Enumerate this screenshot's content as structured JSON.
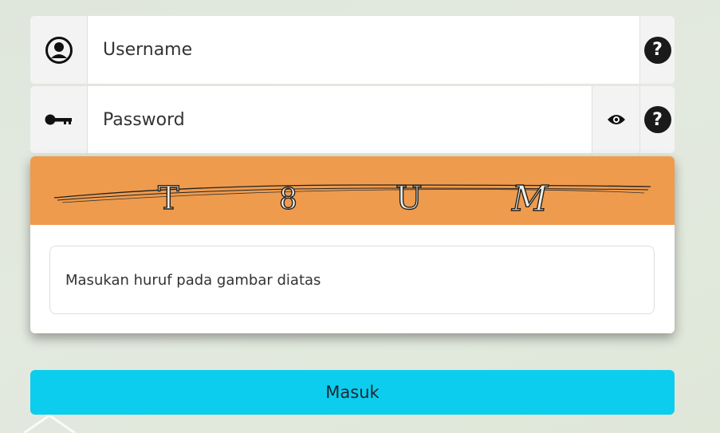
{
  "username": {
    "placeholder": "Username",
    "icon": "user-circle-icon",
    "help_icon": "help-icon"
  },
  "password": {
    "placeholder": "Password",
    "icon": "key-icon",
    "toggle_icon": "eye-icon",
    "help_icon": "help-icon"
  },
  "help_symbol": "?",
  "captcha": {
    "chars": [
      "T",
      "8",
      "U",
      "M"
    ],
    "input_placeholder": "Masukan huruf pada gambar diatas",
    "background_color": "#ef9b4d"
  },
  "submit": {
    "label": "Masuk",
    "color": "#0ccdee"
  }
}
